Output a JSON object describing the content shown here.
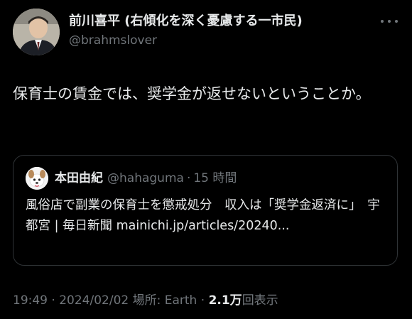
{
  "author": {
    "display_name": "前川喜平 (右傾化を深く憂慮する一市民)",
    "handle": "@brahmslover"
  },
  "post": {
    "text": "保育士の賃金では、奨学金が返せないということか。"
  },
  "quote": {
    "name": "本田由紀",
    "handle": "@hahaguma",
    "separator": "·",
    "time": "15 時間",
    "text": "風俗店で副業の保育士を懲戒処分　収入は「奨学金返済に」　宇都宮 | 毎日新聞 mainichi.jp/articles/20240..."
  },
  "meta": {
    "time": "19:49",
    "dot1": "·",
    "date": "2024/02/02",
    "location": "場所: Earth",
    "dot2": "·",
    "views_count": "2.1万",
    "views_label": "回表示"
  },
  "icons": {
    "more": "more-horizontal-icon",
    "avatar": "author-avatar",
    "quote_avatar": "quoted-author-avatar"
  },
  "colors": {
    "background": "#000000",
    "primary_text": "#e7e9ea",
    "secondary_text": "#71767b",
    "border": "#2f3336"
  }
}
